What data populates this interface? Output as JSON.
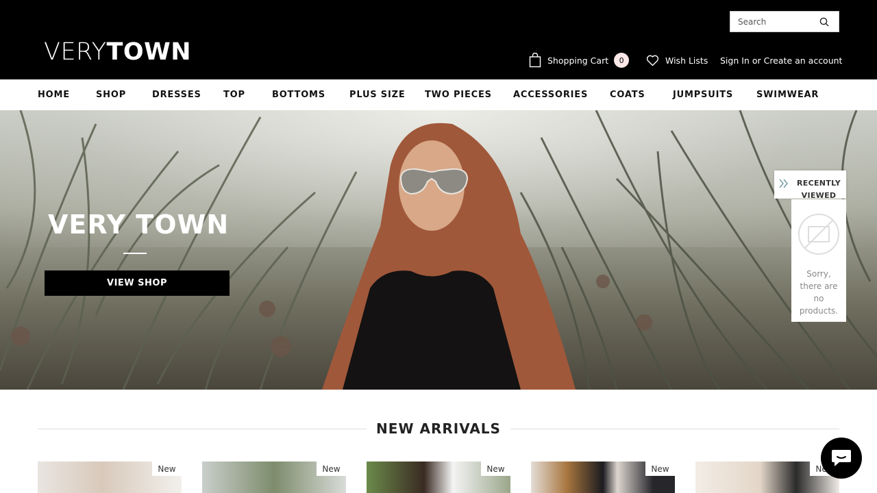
{
  "header": {
    "logo": {
      "thin": "VERY",
      "bold": "TOWN"
    },
    "search": {
      "placeholder": "Search"
    },
    "cart_label": "Shopping Cart",
    "cart_count": "0",
    "wishlist_label": "Wish Lists",
    "sign_in_label": "Sign In",
    "or_text": " or ",
    "create_account_label": "Create an account"
  },
  "nav": {
    "items": [
      "HOME",
      "SHOP",
      "DRESSES",
      "TOP",
      "BOTTOMS",
      "PLUS SIZE",
      "TWO PIECES",
      "ACCESSORIES",
      "COATS",
      "JUMPSUITS",
      "SWIMWEAR"
    ]
  },
  "hero": {
    "title": "VERY TOWN",
    "button_label": "VIEW SHOP"
  },
  "recently_viewed": {
    "title_line1": "RECENTLY",
    "title_line2": "VIEWED",
    "empty_line1": "Sorry,",
    "empty_line2": "there are",
    "empty_line3": "no",
    "empty_line4": "products."
  },
  "new_arrivals": {
    "title": "NEW ARRIVALS",
    "badge_text": "New"
  },
  "icons": {
    "search": "search-icon",
    "cart": "shopping-bag-icon",
    "wishlist": "heart-icon",
    "recently_viewed_toggle": "double-chevron-right-icon",
    "no_image": "no-image-icon",
    "chat": "chat-bubble-icon"
  },
  "colors": {
    "header_bg": "#000000",
    "cart_badge_bg": "#fde8e8",
    "button_bg": "#000000"
  }
}
